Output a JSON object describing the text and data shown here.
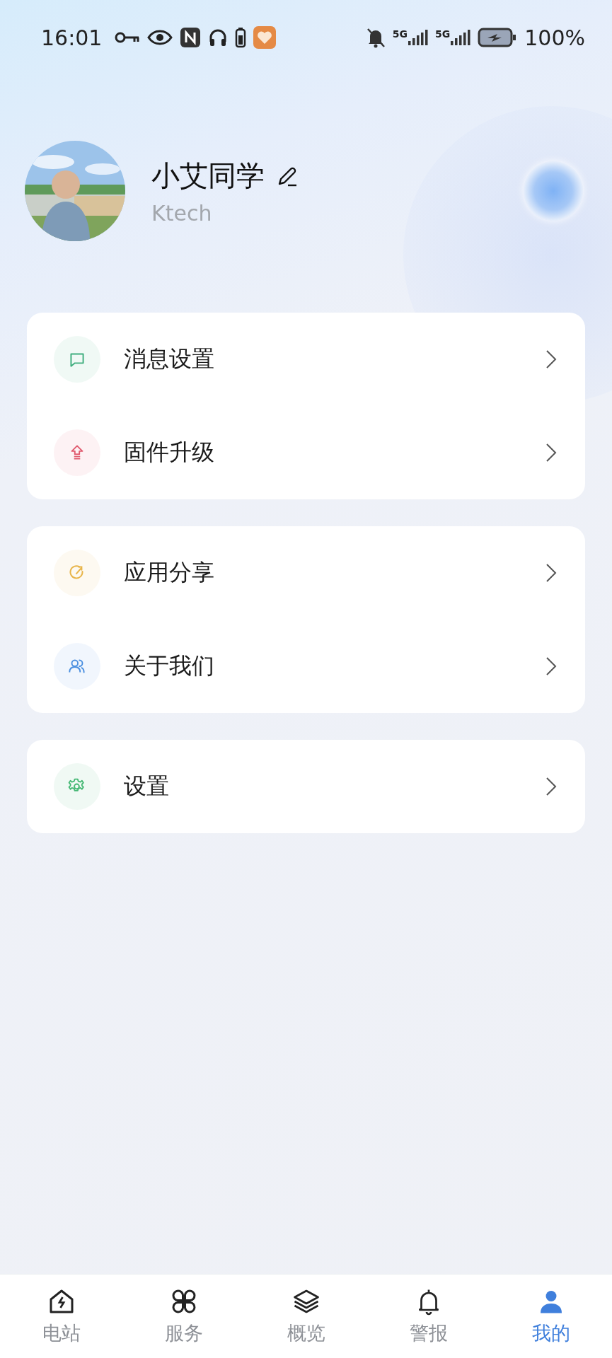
{
  "status_bar": {
    "time": "16:01",
    "network_labels": [
      "5G",
      "5G"
    ],
    "battery": "100%"
  },
  "profile": {
    "name": "小艾同学",
    "subtitle": "Ktech"
  },
  "menu_groups": [
    {
      "items": [
        {
          "label": "消息设置",
          "color": "#3fae7e"
        },
        {
          "label": "固件升级",
          "color": "#e05a6e"
        }
      ]
    },
    {
      "items": [
        {
          "label": "应用分享",
          "color": "#e8b54a"
        },
        {
          "label": "关于我们",
          "color": "#4a8fe0"
        }
      ]
    },
    {
      "items": [
        {
          "label": "设置",
          "color": "#45b874"
        }
      ]
    }
  ],
  "bottom_nav": [
    {
      "label": "电站",
      "selected": false
    },
    {
      "label": "服务",
      "selected": false
    },
    {
      "label": "概览",
      "selected": false
    },
    {
      "label": "警报",
      "selected": false
    },
    {
      "label": "我的",
      "selected": true
    }
  ]
}
